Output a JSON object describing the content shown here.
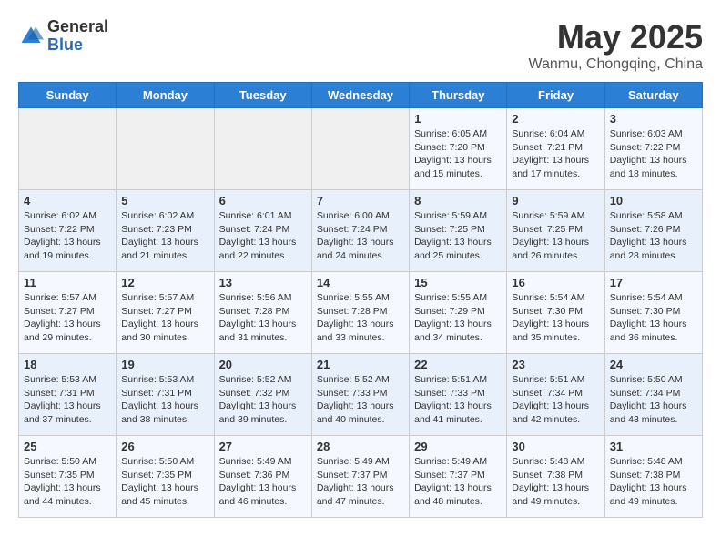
{
  "logo": {
    "general": "General",
    "blue": "Blue"
  },
  "header": {
    "month": "May 2025",
    "location": "Wanmu, Chongqing, China"
  },
  "weekdays": [
    "Sunday",
    "Monday",
    "Tuesday",
    "Wednesday",
    "Thursday",
    "Friday",
    "Saturday"
  ],
  "weeks": [
    [
      {
        "day": "",
        "info": ""
      },
      {
        "day": "",
        "info": ""
      },
      {
        "day": "",
        "info": ""
      },
      {
        "day": "",
        "info": ""
      },
      {
        "day": "1",
        "info": "Sunrise: 6:05 AM\nSunset: 7:20 PM\nDaylight: 13 hours and 15 minutes."
      },
      {
        "day": "2",
        "info": "Sunrise: 6:04 AM\nSunset: 7:21 PM\nDaylight: 13 hours and 17 minutes."
      },
      {
        "day": "3",
        "info": "Sunrise: 6:03 AM\nSunset: 7:22 PM\nDaylight: 13 hours and 18 minutes."
      }
    ],
    [
      {
        "day": "4",
        "info": "Sunrise: 6:02 AM\nSunset: 7:22 PM\nDaylight: 13 hours and 19 minutes."
      },
      {
        "day": "5",
        "info": "Sunrise: 6:02 AM\nSunset: 7:23 PM\nDaylight: 13 hours and 21 minutes."
      },
      {
        "day": "6",
        "info": "Sunrise: 6:01 AM\nSunset: 7:24 PM\nDaylight: 13 hours and 22 minutes."
      },
      {
        "day": "7",
        "info": "Sunrise: 6:00 AM\nSunset: 7:24 PM\nDaylight: 13 hours and 24 minutes."
      },
      {
        "day": "8",
        "info": "Sunrise: 5:59 AM\nSunset: 7:25 PM\nDaylight: 13 hours and 25 minutes."
      },
      {
        "day": "9",
        "info": "Sunrise: 5:59 AM\nSunset: 7:25 PM\nDaylight: 13 hours and 26 minutes."
      },
      {
        "day": "10",
        "info": "Sunrise: 5:58 AM\nSunset: 7:26 PM\nDaylight: 13 hours and 28 minutes."
      }
    ],
    [
      {
        "day": "11",
        "info": "Sunrise: 5:57 AM\nSunset: 7:27 PM\nDaylight: 13 hours and 29 minutes."
      },
      {
        "day": "12",
        "info": "Sunrise: 5:57 AM\nSunset: 7:27 PM\nDaylight: 13 hours and 30 minutes."
      },
      {
        "day": "13",
        "info": "Sunrise: 5:56 AM\nSunset: 7:28 PM\nDaylight: 13 hours and 31 minutes."
      },
      {
        "day": "14",
        "info": "Sunrise: 5:55 AM\nSunset: 7:28 PM\nDaylight: 13 hours and 33 minutes."
      },
      {
        "day": "15",
        "info": "Sunrise: 5:55 AM\nSunset: 7:29 PM\nDaylight: 13 hours and 34 minutes."
      },
      {
        "day": "16",
        "info": "Sunrise: 5:54 AM\nSunset: 7:30 PM\nDaylight: 13 hours and 35 minutes."
      },
      {
        "day": "17",
        "info": "Sunrise: 5:54 AM\nSunset: 7:30 PM\nDaylight: 13 hours and 36 minutes."
      }
    ],
    [
      {
        "day": "18",
        "info": "Sunrise: 5:53 AM\nSunset: 7:31 PM\nDaylight: 13 hours and 37 minutes."
      },
      {
        "day": "19",
        "info": "Sunrise: 5:53 AM\nSunset: 7:31 PM\nDaylight: 13 hours and 38 minutes."
      },
      {
        "day": "20",
        "info": "Sunrise: 5:52 AM\nSunset: 7:32 PM\nDaylight: 13 hours and 39 minutes."
      },
      {
        "day": "21",
        "info": "Sunrise: 5:52 AM\nSunset: 7:33 PM\nDaylight: 13 hours and 40 minutes."
      },
      {
        "day": "22",
        "info": "Sunrise: 5:51 AM\nSunset: 7:33 PM\nDaylight: 13 hours and 41 minutes."
      },
      {
        "day": "23",
        "info": "Sunrise: 5:51 AM\nSunset: 7:34 PM\nDaylight: 13 hours and 42 minutes."
      },
      {
        "day": "24",
        "info": "Sunrise: 5:50 AM\nSunset: 7:34 PM\nDaylight: 13 hours and 43 minutes."
      }
    ],
    [
      {
        "day": "25",
        "info": "Sunrise: 5:50 AM\nSunset: 7:35 PM\nDaylight: 13 hours and 44 minutes."
      },
      {
        "day": "26",
        "info": "Sunrise: 5:50 AM\nSunset: 7:35 PM\nDaylight: 13 hours and 45 minutes."
      },
      {
        "day": "27",
        "info": "Sunrise: 5:49 AM\nSunset: 7:36 PM\nDaylight: 13 hours and 46 minutes."
      },
      {
        "day": "28",
        "info": "Sunrise: 5:49 AM\nSunset: 7:37 PM\nDaylight: 13 hours and 47 minutes."
      },
      {
        "day": "29",
        "info": "Sunrise: 5:49 AM\nSunset: 7:37 PM\nDaylight: 13 hours and 48 minutes."
      },
      {
        "day": "30",
        "info": "Sunrise: 5:48 AM\nSunset: 7:38 PM\nDaylight: 13 hours and 49 minutes."
      },
      {
        "day": "31",
        "info": "Sunrise: 5:48 AM\nSunset: 7:38 PM\nDaylight: 13 hours and 49 minutes."
      }
    ]
  ]
}
